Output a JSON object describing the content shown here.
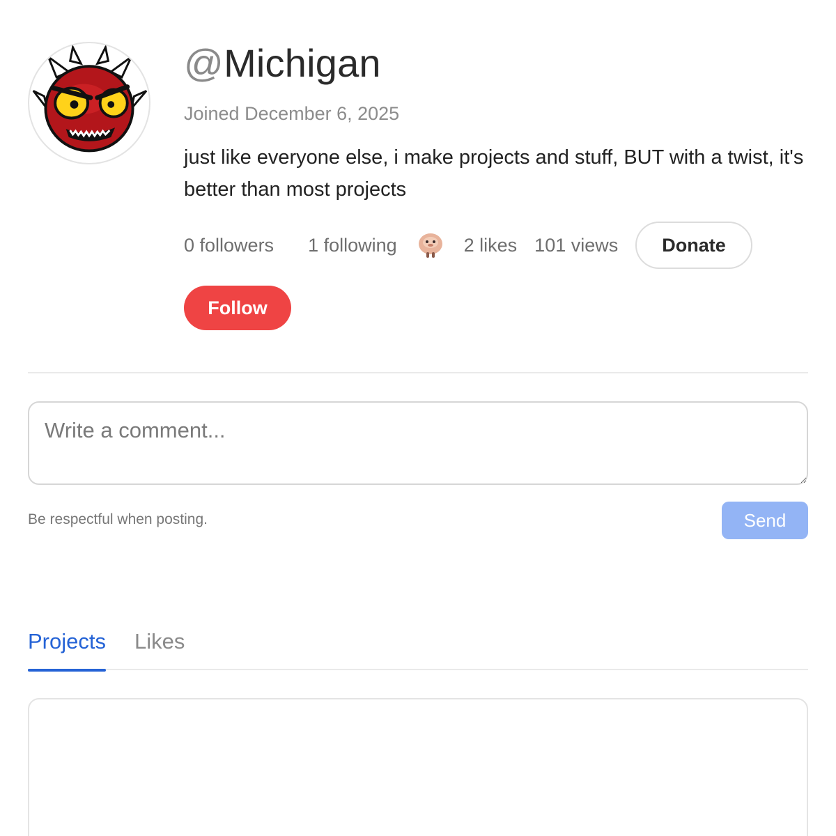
{
  "profile": {
    "at_symbol": "@",
    "username": "Michigan",
    "joined": "Joined December 6, 2025",
    "bio": "just like everyone else, i make projects and stuff, BUT with a twist, it's better than most projects",
    "avatar_icon": "red-demon-face-icon"
  },
  "stats": {
    "followers": "0 followers",
    "following": "1 following",
    "following_avatar_icon": "pink-creature-icon",
    "likes": "2 likes",
    "views": "101 views"
  },
  "buttons": {
    "donate": "Donate",
    "follow": "Follow",
    "send": "Send"
  },
  "comment": {
    "placeholder": "Write a comment...",
    "hint": "Be respectful when posting."
  },
  "tabs": [
    {
      "label": "Projects",
      "active": true
    },
    {
      "label": "Likes",
      "active": false
    }
  ],
  "colors": {
    "follow": "#ef4444",
    "send": "#93b4f5",
    "active_tab": "#2563d6"
  }
}
